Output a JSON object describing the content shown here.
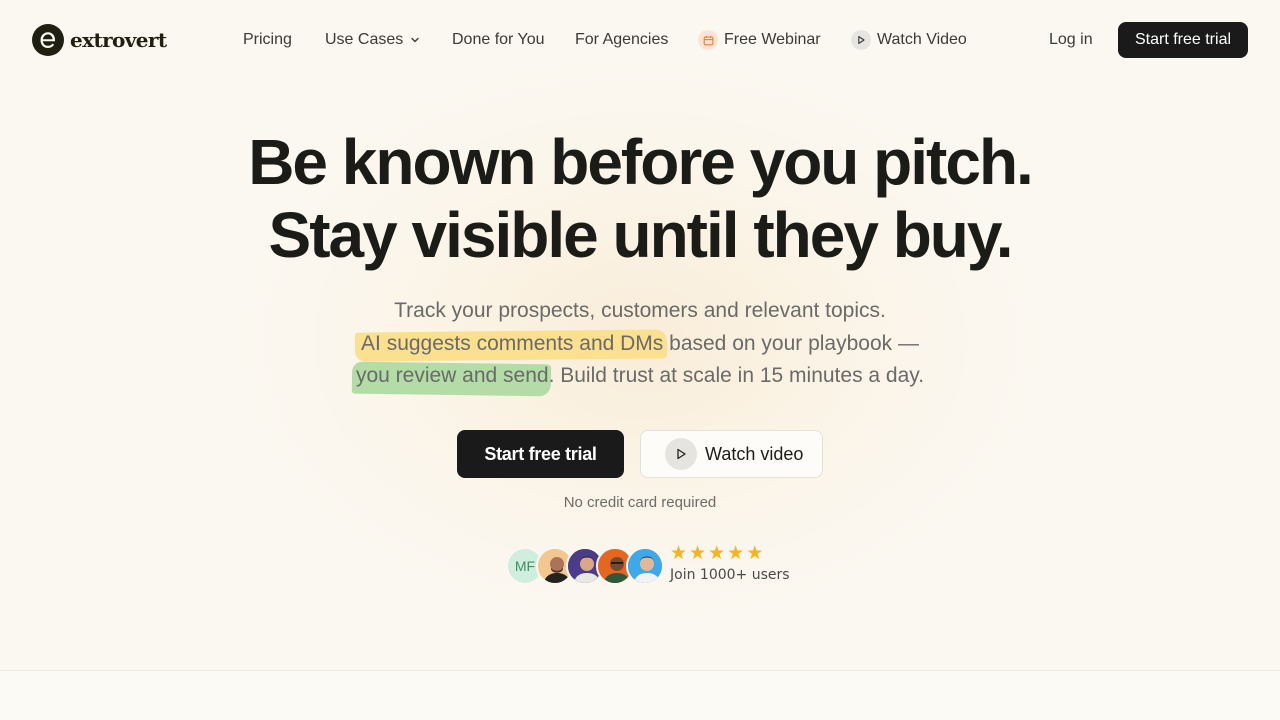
{
  "brand": {
    "name": "extrovert",
    "mark": "e"
  },
  "nav": {
    "links": [
      {
        "label": "Pricing"
      },
      {
        "label": "Use Cases"
      },
      {
        "label": "Done for You"
      },
      {
        "label": "For Agencies"
      },
      {
        "label": "Free Webinar",
        "icon": "calendar-icon"
      },
      {
        "label": "Watch Video",
        "icon": "play-icon"
      }
    ],
    "login_label": "Log in",
    "trial_label": "Start free trial"
  },
  "hero": {
    "headline_line1": "Be known before you pitch.",
    "headline_line2": "Stay visible until they buy.",
    "sub_line1": "Track your prospects, customers and relevant topics.",
    "sub_highlight1": "AI suggests comments and DMs",
    "sub_line2_rest": " based on your playbook —",
    "sub_highlight2": "you review and send",
    "sub_line3_rest": ". Build trust at scale in 15 minutes a day.",
    "primary_cta": "Start free trial",
    "secondary_cta": "Watch video",
    "note": "No credit card required"
  },
  "social_proof": {
    "avatar_initials": "MF",
    "rating_stars": 5,
    "label": "Join 1000+ users"
  },
  "colors": {
    "background": "#fbf8f1",
    "dark_button": "#1a1a1a",
    "highlight_yellow": "#fbe08f",
    "highlight_green": "#b3dca6",
    "star": "#f5b41e",
    "webinar_icon_bg": "#fde4d2",
    "webinar_icon": "#f07b3a"
  }
}
